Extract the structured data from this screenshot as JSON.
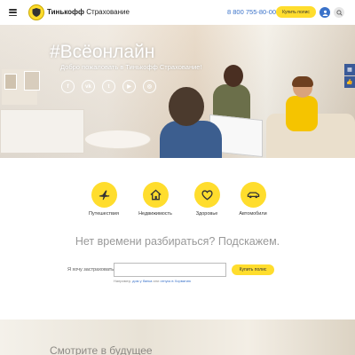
{
  "header": {
    "brand_bold": "Тинькофф",
    "brand_rest": " Страхование",
    "phone": "8 800 755-80-00",
    "buy_label": "Купить полис"
  },
  "hero": {
    "title": "#Всёонлайн",
    "subtitle": "Добро пожаловать в Тинькофф Страхование!",
    "socials": [
      {
        "name": "facebook-icon",
        "glyph": "f"
      },
      {
        "name": "vk-icon",
        "glyph": "vk"
      },
      {
        "name": "twitter-icon",
        "glyph": "t"
      },
      {
        "name": "youtube-icon",
        "glyph": "▶"
      },
      {
        "name": "instagram-icon",
        "glyph": "◎"
      }
    ]
  },
  "categories": [
    {
      "label": "Путешествия",
      "icon": "plane-icon"
    },
    {
      "label": "Недвижимость",
      "icon": "house-icon"
    },
    {
      "label": "Здоровье",
      "icon": "heart-icon"
    },
    {
      "label": "Автомобили",
      "icon": "car-icon"
    }
  ],
  "tagline": "Нет времени разбираться? Подскажем.",
  "form": {
    "label": "Я хочу застраховать",
    "input_value": "",
    "buy_label": "Купить полис",
    "hint_prefix": "Например, ",
    "hint_link1": "дом у банка",
    "hint_mid": " или ",
    "hint_link2": "отпуск в Хорватию"
  },
  "bottom": {
    "title": "Смотрите в будущее"
  },
  "colors": {
    "accent_yellow": "#ffdd2d",
    "link_blue": "#3a72c9"
  }
}
